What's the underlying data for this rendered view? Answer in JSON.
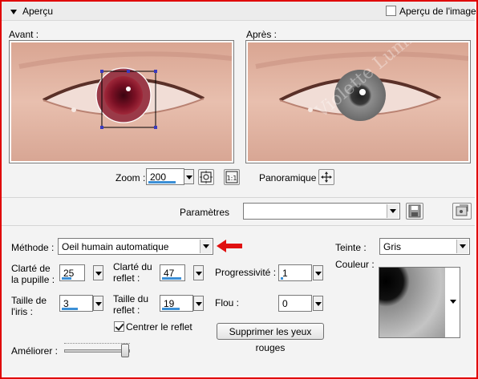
{
  "header": {
    "title": "Aperçu",
    "image_preview_checkbox_label": "Aperçu de l'image",
    "image_preview_checked": false
  },
  "preview": {
    "before_label": "Avant :",
    "after_label": "Après :",
    "zoom_label": "Zoom :",
    "zoom_value": "200",
    "pan_label": "Panoramique :",
    "watermark": "Violette Lumino"
  },
  "params": {
    "label": "Paramètres",
    "value": ""
  },
  "settings": {
    "method_label": "Méthode :",
    "method_value": "Oeil humain automatique",
    "pupil_clarity_label_line1": "Clarté de",
    "pupil_clarity_label_line2": "la pupille :",
    "pupil_clarity_value": "25",
    "reflection_clarity_label_line1": "Clarté du",
    "reflection_clarity_label_line2": "reflet :",
    "reflection_clarity_value": "47",
    "progressivity_label": "Progressivité :",
    "progressivity_value": "1",
    "iris_size_label_line1": "Taille de",
    "iris_size_label_line2": "l'iris :",
    "iris_size_value": "3",
    "reflection_size_label_line1": "Taille du",
    "reflection_size_label_line2": "reflet :",
    "reflection_size_value": "19",
    "blur_label": "Flou :",
    "blur_value": "0",
    "center_reflection_label": "Centrer le reflet",
    "center_reflection_checked": true,
    "remove_red_eyes_label": "Supprimer les yeux rouges",
    "improve_label": "Améliorer :",
    "hue_label": "Teinte :",
    "hue_value": "Gris",
    "color_label": "Couleur :"
  },
  "colors": {
    "border_red": "#e00000",
    "accent_blue": "#3b8fd6",
    "arrow_red": "#e01010"
  }
}
